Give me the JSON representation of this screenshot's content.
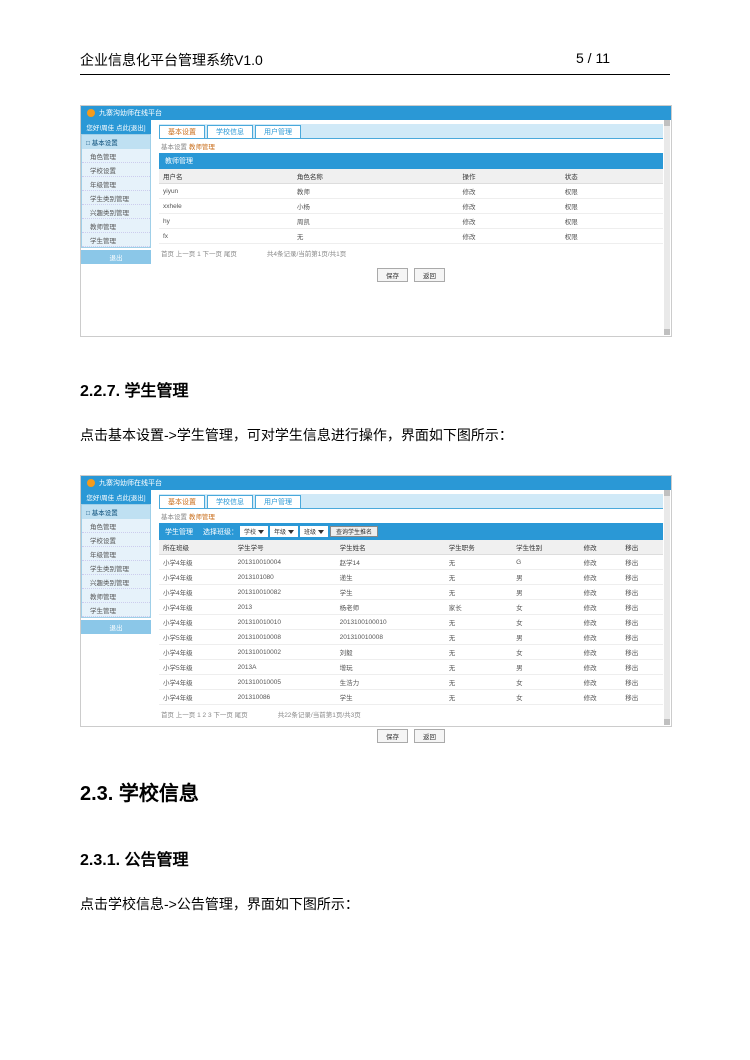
{
  "header": {
    "left": "企业信息化平台管理系统V1.0",
    "right": "5 / 11"
  },
  "screenshot1": {
    "appTitle": "九寨沟幼师在线平台",
    "tabs": [
      "基本设置",
      "学校信息",
      "用户管理"
    ],
    "navHeader": "您好!周佳 点此[退出]",
    "navBoxTitle": "□ 基本设置",
    "navItems": [
      "角色管理",
      "学校设置",
      "年级管理",
      "学生类别管理",
      "兴趣类别管理",
      "教师管理",
      "学生管理"
    ],
    "navBtn": "退出",
    "crumbPrefix": "基本设置 ",
    "crumbActive": "教师管理",
    "panelTitle": "教师管理",
    "cols": [
      "用户名",
      "角色名称",
      "操作",
      "状态"
    ],
    "rows": [
      {
        "c0": "yiyun",
        "c1": "教师",
        "c2": "修改",
        "c3": "权限"
      },
      {
        "c0": "xxhele",
        "c1": "小杨",
        "c2": "修改",
        "c3": "权限"
      },
      {
        "c0": "hy",
        "c1": "周凯",
        "c2": "修改",
        "c3": "权限"
      },
      {
        "c0": "fx",
        "c1": "无",
        "c2": "修改",
        "c3": "权限"
      }
    ],
    "pagerLeft": "首页 上一页 1 下一页 尾页",
    "pagerRight": "共4条记录/当前第1页/共1页",
    "btn1": "保存",
    "btn2": "返回"
  },
  "sec227": {
    "title": "2.2.7. 学生管理",
    "para": "点击基本设置->学生管理，可对学生信息进行操作，界面如下图所示："
  },
  "screenshot2": {
    "appTitle": "九寨沟幼师在线平台",
    "tabs": [
      "基本设置",
      "学校信息",
      "用户管理"
    ],
    "navHeader": "您好!周佳 点此[退出]",
    "navBoxTitle": "□ 基本设置",
    "navItems": [
      "角色管理",
      "学校设置",
      "年级管理",
      "学生类别管理",
      "兴趣类别管理",
      "教师管理",
      "学生管理"
    ],
    "navBtn": "退出",
    "crumbPrefix": "基本设置 ",
    "crumbActive": "教师管理",
    "filterHeader": "学生管理",
    "filterLabels": {
      "schoolLbl": "选择班级：",
      "schoolSel": "学校",
      "gradeSel": "年级",
      "classSel": "班级",
      "btn": "查询学生推名"
    },
    "cols": [
      "所在班级",
      "学生学号",
      "学生姓名",
      "学生职务",
      "学生性别",
      "修改",
      "移出"
    ],
    "rows": [
      {
        "c0": "小学4年级",
        "c1": "201310010004",
        "c2": "赵学14",
        "c3": "无",
        "c4": "G",
        "c5": "修改",
        "c6": "移出"
      },
      {
        "c0": "小学4年级",
        "c1": "2013101080",
        "c2": "递生",
        "c3": "无",
        "c4": "男",
        "c5": "修改",
        "c6": "移出"
      },
      {
        "c0": "小学4年级",
        "c1": "201310010082",
        "c2": "学生",
        "c3": "无",
        "c4": "男",
        "c5": "修改",
        "c6": "移出"
      },
      {
        "c0": "小学4年级",
        "c1": "2013",
        "c2": "杨老师",
        "c3": "家长",
        "c4": "女",
        "c5": "修改",
        "c6": "移出"
      },
      {
        "c0": "小学4年级",
        "c1": "201310010010",
        "c2": "2013100100010",
        "c3": "无",
        "c4": "女",
        "c5": "修改",
        "c6": "移出"
      },
      {
        "c0": "小学5年级",
        "c1": "201310010008",
        "c2": "201310010008",
        "c3": "无",
        "c4": "男",
        "c5": "修改",
        "c6": "移出"
      },
      {
        "c0": "小学4年级",
        "c1": "201310010002",
        "c2": "刘毅",
        "c3": "无",
        "c4": "女",
        "c5": "修改",
        "c6": "移出"
      },
      {
        "c0": "小学5年级",
        "c1": "2013A",
        "c2": "增玩",
        "c3": "无",
        "c4": "男",
        "c5": "修改",
        "c6": "移出"
      },
      {
        "c0": "小学4年级",
        "c1": "201310010005",
        "c2": "生浩力",
        "c3": "无",
        "c4": "女",
        "c5": "修改",
        "c6": "移出"
      },
      {
        "c0": "小学4年级",
        "c1": "201310086",
        "c2": "学生",
        "c3": "无",
        "c4": "女",
        "c5": "修改",
        "c6": "移出"
      }
    ],
    "pagerLeft": "首页 上一页 1 2 3 下一页 尾页",
    "pagerRight": "共22条记录/当前第1页/共3页",
    "btn1": "保存",
    "btn2": "返回"
  },
  "sec23": {
    "title": "2.3. 学校信息"
  },
  "sec231": {
    "title": "2.3.1. 公告管理",
    "para": "点击学校信息->公告管理，界面如下图所示："
  }
}
